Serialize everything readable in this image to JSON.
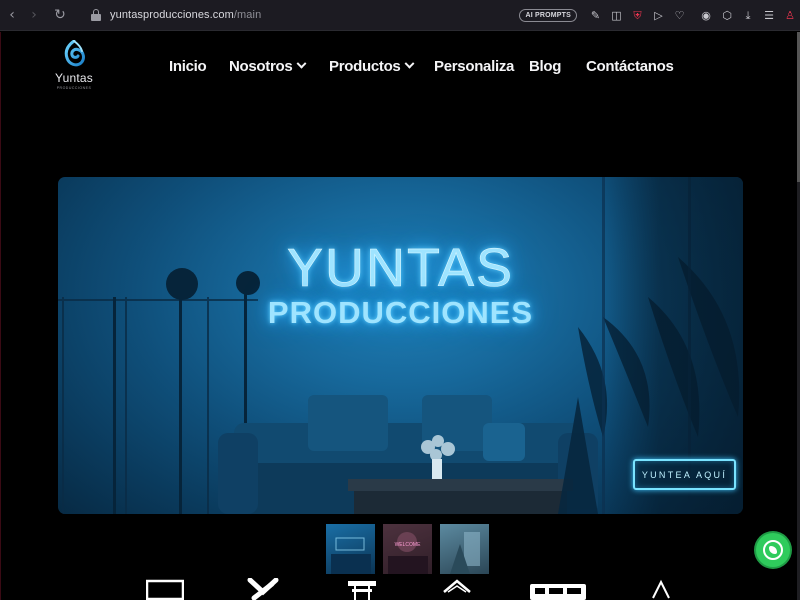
{
  "browser": {
    "url_host": "yuntasproducciones.com",
    "url_path": "/main",
    "ai_prompts_label": "AI PROMPTS",
    "icons": [
      "back-icon",
      "forward-icon",
      "reload-icon",
      "lock-icon",
      "ai-prompts-badge",
      "edit-icon",
      "screenshot-icon",
      "shield-icon",
      "play-icon",
      "heart-icon",
      "extension-icon",
      "cube-icon",
      "download-icon",
      "menu-icon",
      "profile-icon"
    ]
  },
  "site": {
    "logo_text": "Yuntas",
    "logo_sub": "PRODUCCIONES",
    "nav": [
      {
        "label": "Inicio",
        "dropdown": false
      },
      {
        "label": "Nosotros",
        "dropdown": true
      },
      {
        "label": "Productos",
        "dropdown": true
      },
      {
        "label": "Personaliza",
        "dropdown": false
      },
      {
        "label": "Blog",
        "dropdown": false
      },
      {
        "label": "Contáctanos",
        "dropdown": false
      }
    ]
  },
  "hero": {
    "title": "YUNTAS",
    "subtitle": "PRODUCCIONES",
    "cta": "YUNTEA AQUÍ"
  },
  "thumbnails": [
    {
      "label": ""
    },
    {
      "label": "WELCOME"
    },
    {
      "label": ""
    }
  ],
  "categories": [
    "monitor-icon",
    "tools-icon",
    "stand-icon",
    "tent-icon",
    "display-panel-icon",
    "tripod-icon"
  ],
  "colors": {
    "accent_neon": "#79e3ff",
    "whatsapp": "#2fcb5c",
    "background": "#000000"
  }
}
